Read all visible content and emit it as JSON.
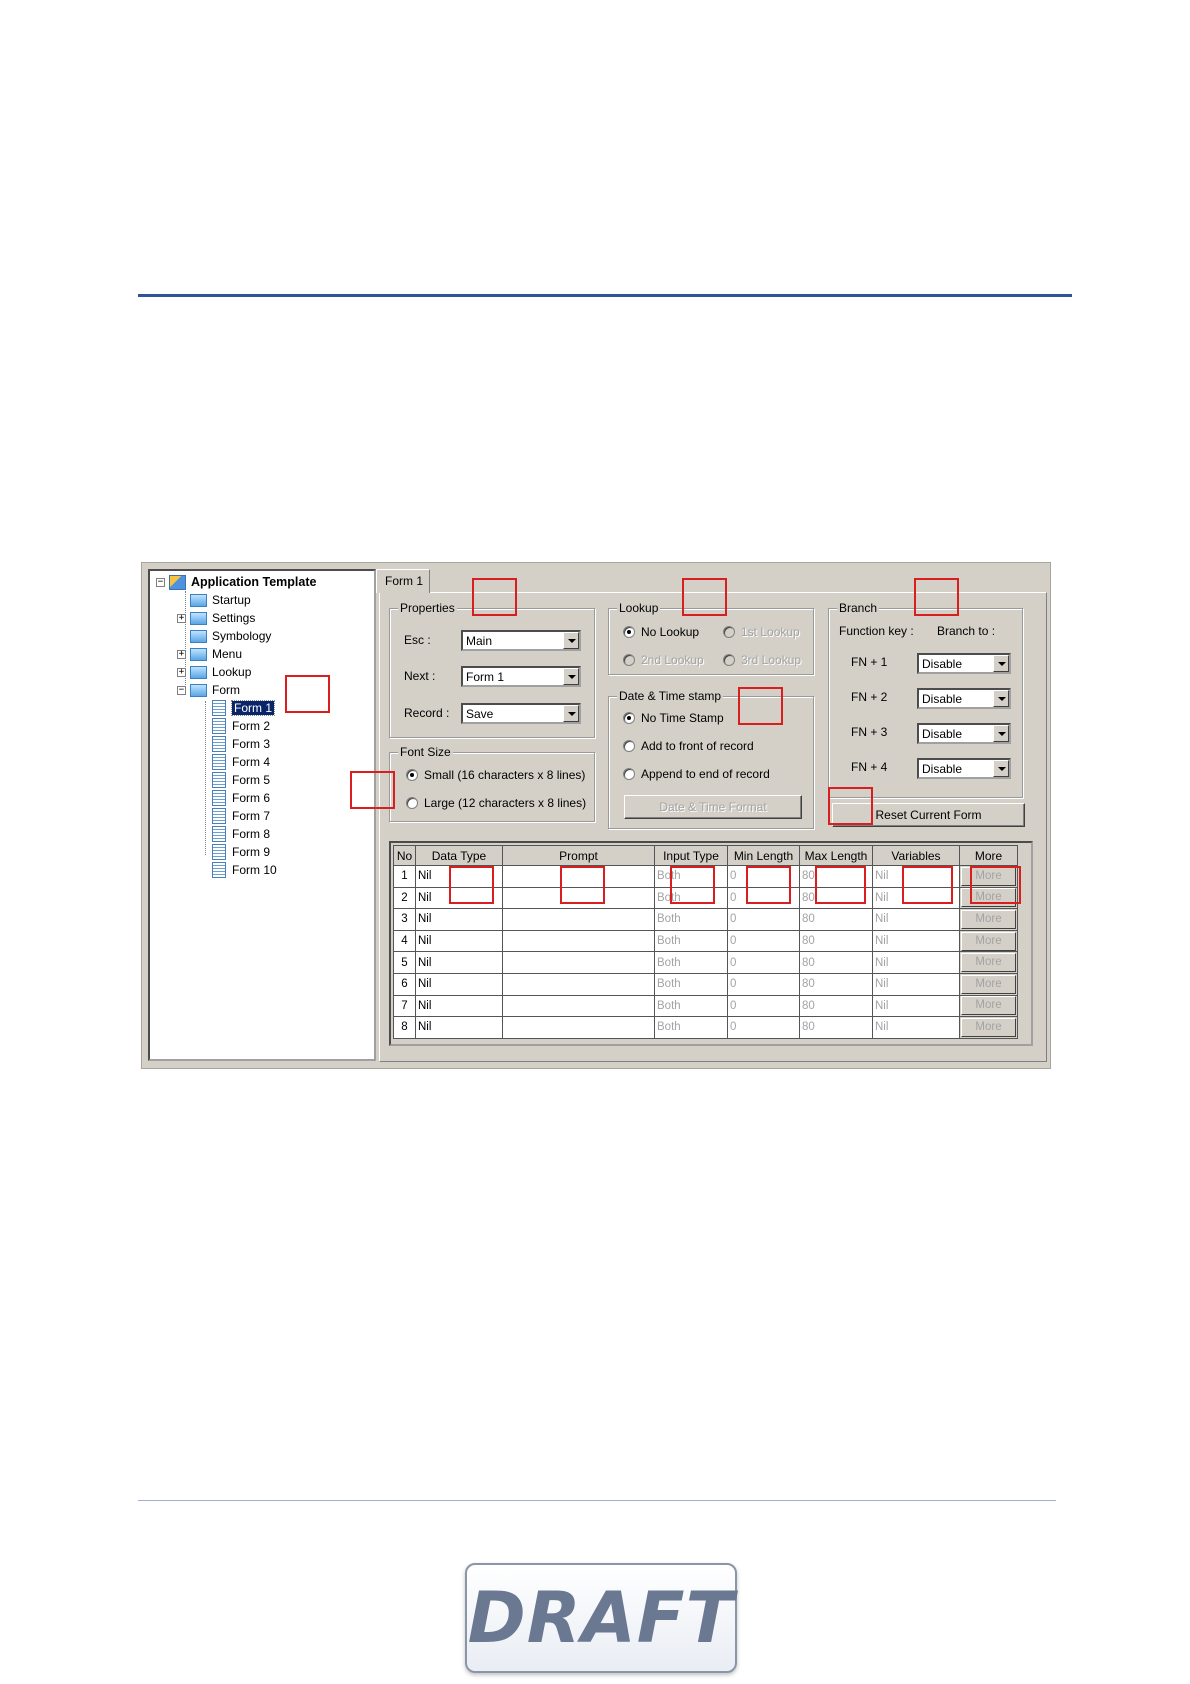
{
  "tree": {
    "root": "Application Template",
    "items": [
      "Startup",
      "Settings",
      "Symbology",
      "Menu",
      "Lookup",
      "Form"
    ],
    "forms": [
      "Form 1",
      "Form 2",
      "Form 3",
      "Form 4",
      "Form 5",
      "Form 6",
      "Form 7",
      "Form 8",
      "Form 9",
      "Form 10"
    ],
    "selected": "Form 1"
  },
  "tab": {
    "label": "Form 1"
  },
  "properties": {
    "title": "Properties",
    "esc_label": "Esc :",
    "esc_value": "Main",
    "next_label": "Next :",
    "next_value": "Form 1",
    "record_label": "Record :",
    "record_value": "Save"
  },
  "font_size": {
    "title": "Font Size",
    "small": "Small (16 characters x 8 lines)",
    "large": "Large (12 characters x 8 lines)"
  },
  "lookup": {
    "title": "Lookup",
    "no": "No Lookup",
    "first": "1st Lookup",
    "second": "2nd Lookup",
    "third": "3rd Lookup"
  },
  "datetime": {
    "title": "Date & Time stamp",
    "none": "No Time Stamp",
    "front": "Add to front of record",
    "end": "Append to end of record",
    "format_button": "Date & Time Format"
  },
  "branch": {
    "title": "Branch",
    "function_key": "Function key :",
    "branch_to": "Branch to :",
    "rows": [
      {
        "key": "FN + 1",
        "value": "Disable"
      },
      {
        "key": "FN + 2",
        "value": "Disable"
      },
      {
        "key": "FN + 3",
        "value": "Disable"
      },
      {
        "key": "FN + 4",
        "value": "Disable"
      }
    ],
    "reset_button": "Reset Current Form"
  },
  "table": {
    "headers": [
      "No",
      "Data Type",
      "Prompt",
      "Input Type",
      "Min Length",
      "Max Length",
      "Variables",
      "More"
    ],
    "rows": [
      {
        "no": "1",
        "data_type": "Nil",
        "prompt": "",
        "input_type": "Both",
        "min": "0",
        "max": "80",
        "variables": "Nil",
        "more": "More"
      },
      {
        "no": "2",
        "data_type": "Nil",
        "prompt": "",
        "input_type": "Both",
        "min": "0",
        "max": "80",
        "variables": "Nil",
        "more": "More"
      },
      {
        "no": "3",
        "data_type": "Nil",
        "prompt": "",
        "input_type": "Both",
        "min": "0",
        "max": "80",
        "variables": "Nil",
        "more": "More"
      },
      {
        "no": "4",
        "data_type": "Nil",
        "prompt": "",
        "input_type": "Both",
        "min": "0",
        "max": "80",
        "variables": "Nil",
        "more": "More"
      },
      {
        "no": "5",
        "data_type": "Nil",
        "prompt": "",
        "input_type": "Both",
        "min": "0",
        "max": "80",
        "variables": "Nil",
        "more": "More"
      },
      {
        "no": "6",
        "data_type": "Nil",
        "prompt": "",
        "input_type": "Both",
        "min": "0",
        "max": "80",
        "variables": "Nil",
        "more": "More"
      },
      {
        "no": "7",
        "data_type": "Nil",
        "prompt": "",
        "input_type": "Both",
        "min": "0",
        "max": "80",
        "variables": "Nil",
        "more": "More"
      },
      {
        "no": "8",
        "data_type": "Nil",
        "prompt": "",
        "input_type": "Both",
        "min": "0",
        "max": "80",
        "variables": "Nil",
        "more": "More"
      }
    ]
  },
  "watermark": {
    "text": "DRAFT"
  },
  "colors": {
    "rule": "#2f5597",
    "callout": "#d81e1e",
    "selection": "#0a246a"
  }
}
